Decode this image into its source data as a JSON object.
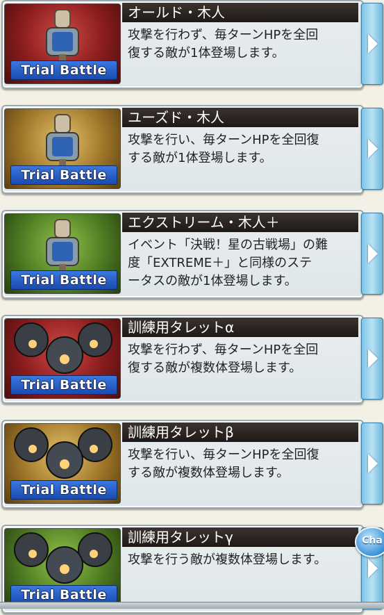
{
  "badge_label": "Trial Battle",
  "chat_label": "Cha",
  "items": [
    {
      "title": "オールド・木人",
      "description_line1": "攻撃を行わず、毎ターンHPを全回",
      "description_line2": "復する敵が1体登場します。",
      "description_line3": "",
      "thumb_color": "red",
      "icon": "training-dummy-icon"
    },
    {
      "title": "ユーズド・木人",
      "description_line1": "攻撃を行い、毎ターンHPを全回復",
      "description_line2": "する敵が1体登場します。",
      "description_line3": "",
      "thumb_color": "gold",
      "icon": "training-dummy-icon"
    },
    {
      "title": "エクストリーム・木人＋",
      "description_line1": "イベント「決戦！星の古戦場」の難",
      "description_line2": "度「EXTREME＋」と同様のステ",
      "description_line3": "ータスの敵が1体登場します。",
      "thumb_color": "green",
      "icon": "training-dummy-icon"
    },
    {
      "title": "訓練用タレットα",
      "description_line1": "攻撃を行わず、毎ターンHPを全回",
      "description_line2": "復する敵が複数体登場します。",
      "description_line3": "",
      "thumb_color": "red",
      "icon": "turret-icon"
    },
    {
      "title": "訓練用タレットβ",
      "description_line1": "攻撃を行い、毎ターンHPを全回復",
      "description_line2": "する敵が複数体登場します。",
      "description_line3": "",
      "thumb_color": "gold",
      "icon": "turret-icon"
    },
    {
      "title": "訓練用タレットγ",
      "description_line1": "攻撃を行う敵が複数体登場します。",
      "description_line2": "",
      "description_line3": "",
      "thumb_color": "green",
      "icon": "turret-icon"
    }
  ]
}
